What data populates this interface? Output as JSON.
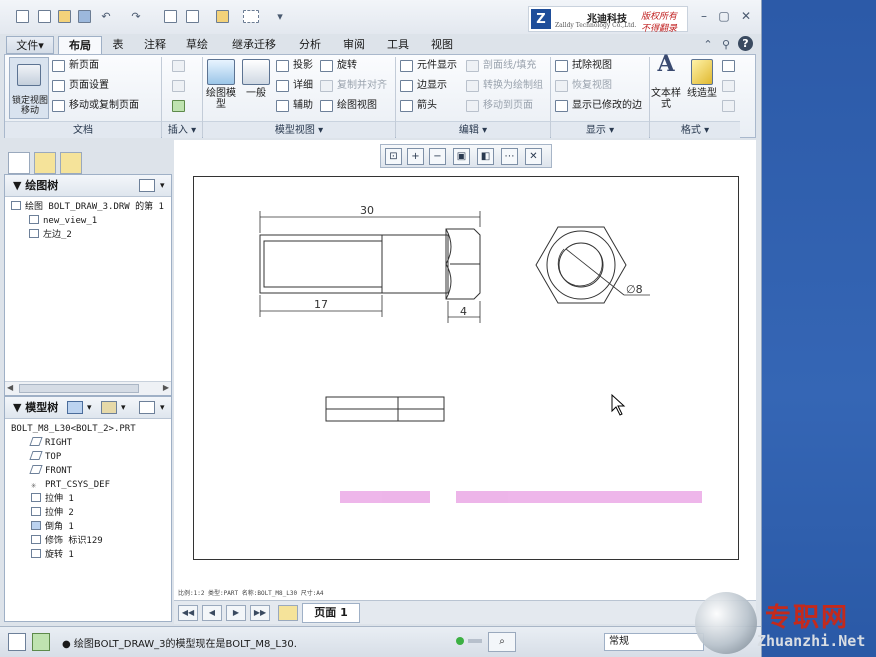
{
  "titlebar": {
    "logo_letter": "Z",
    "logo_cn": "兆迪科技",
    "logo_en": "Zalldy Technology Co.,Ltd.",
    "slogan1": "版权所有",
    "slogan2": "不得翻录",
    "minimize": "–",
    "restore": "▢",
    "close": "✕"
  },
  "tabs": [
    {
      "label": "文件▾"
    },
    {
      "label": "布局"
    },
    {
      "label": "表"
    },
    {
      "label": "注释"
    },
    {
      "label": "草绘"
    },
    {
      "label": "继承迁移"
    },
    {
      "label": "分析"
    },
    {
      "label": "审阅"
    },
    {
      "label": "工具"
    },
    {
      "label": "视图"
    }
  ],
  "ribbon": {
    "lock_view": "锁定视图移动",
    "new_page": "新页面",
    "page_setup": "页面设置",
    "move_copy_page": "移动或复制页面",
    "drawing_model": "绘图模型",
    "general": "一般",
    "projection": "投影",
    "detail": "详细",
    "auxiliary": "辅助",
    "revolve": "旋转",
    "copy_align": "复制并对齐",
    "drawing_view": "绘图视图",
    "element_display": "元件显示",
    "edge_display": "边显示",
    "arrow": "箭头",
    "section_fill": "剖面线/填充",
    "convert_group": "转换为绘制组",
    "move_to_page": "移动到页面",
    "erase_view": "拭除视图",
    "restore_view": "恢复视图",
    "show_modified_edges": "显示已修改的边",
    "text_style": "文本样式",
    "line_style": "线造型",
    "groups": {
      "document": "文档",
      "insert": "插入 ▾",
      "model_views": "模型视图 ▾",
      "edit": "编辑 ▾",
      "display": "显示 ▾",
      "format": "格式 ▾"
    }
  },
  "drawing_tree": {
    "title": "绘图树",
    "items": [
      {
        "label": "绘图 BOLT_DRAW_3.DRW 的第 1"
      },
      {
        "label": "new_view_1"
      },
      {
        "label": "左边_2"
      }
    ]
  },
  "model_tree": {
    "title": "模型树",
    "root": "BOLT_M8_L30<BOLT_2>.PRT",
    "items": [
      {
        "label": "RIGHT"
      },
      {
        "label": "TOP"
      },
      {
        "label": "FRONT"
      },
      {
        "label": "PRT_CSYS_DEF"
      },
      {
        "label": "拉伸 1"
      },
      {
        "label": "拉伸 2"
      },
      {
        "label": "倒角 1"
      },
      {
        "label": "修饰 标识129"
      },
      {
        "label": "旋转 1"
      }
    ]
  },
  "drawing": {
    "dim_length": "30",
    "dim_thread": "17",
    "dim_head": "4",
    "dim_diameter": "∅8"
  },
  "sheet_info": "比例:1:2   类型:PART   名称:BOLT_M8_L30   尺寸:A4",
  "pagebar": {
    "first": "◀◀",
    "prev": "◀",
    "next": "▶",
    "last": "▶▶",
    "page_label": "页面 1"
  },
  "status": {
    "message": "● 绘图BOLT_DRAW_3的模型现在是BOLT_M8_L30.",
    "filter": "常规"
  },
  "watermark": {
    "title": "专职网",
    "url": "Zhuanzhi.Net"
  },
  "colors": {
    "frame_blue": "#2a5aa8",
    "ribbon_bg": "#f2f5f9",
    "drawing_line": "#333333",
    "watermark_red": "#c42a1c"
  }
}
